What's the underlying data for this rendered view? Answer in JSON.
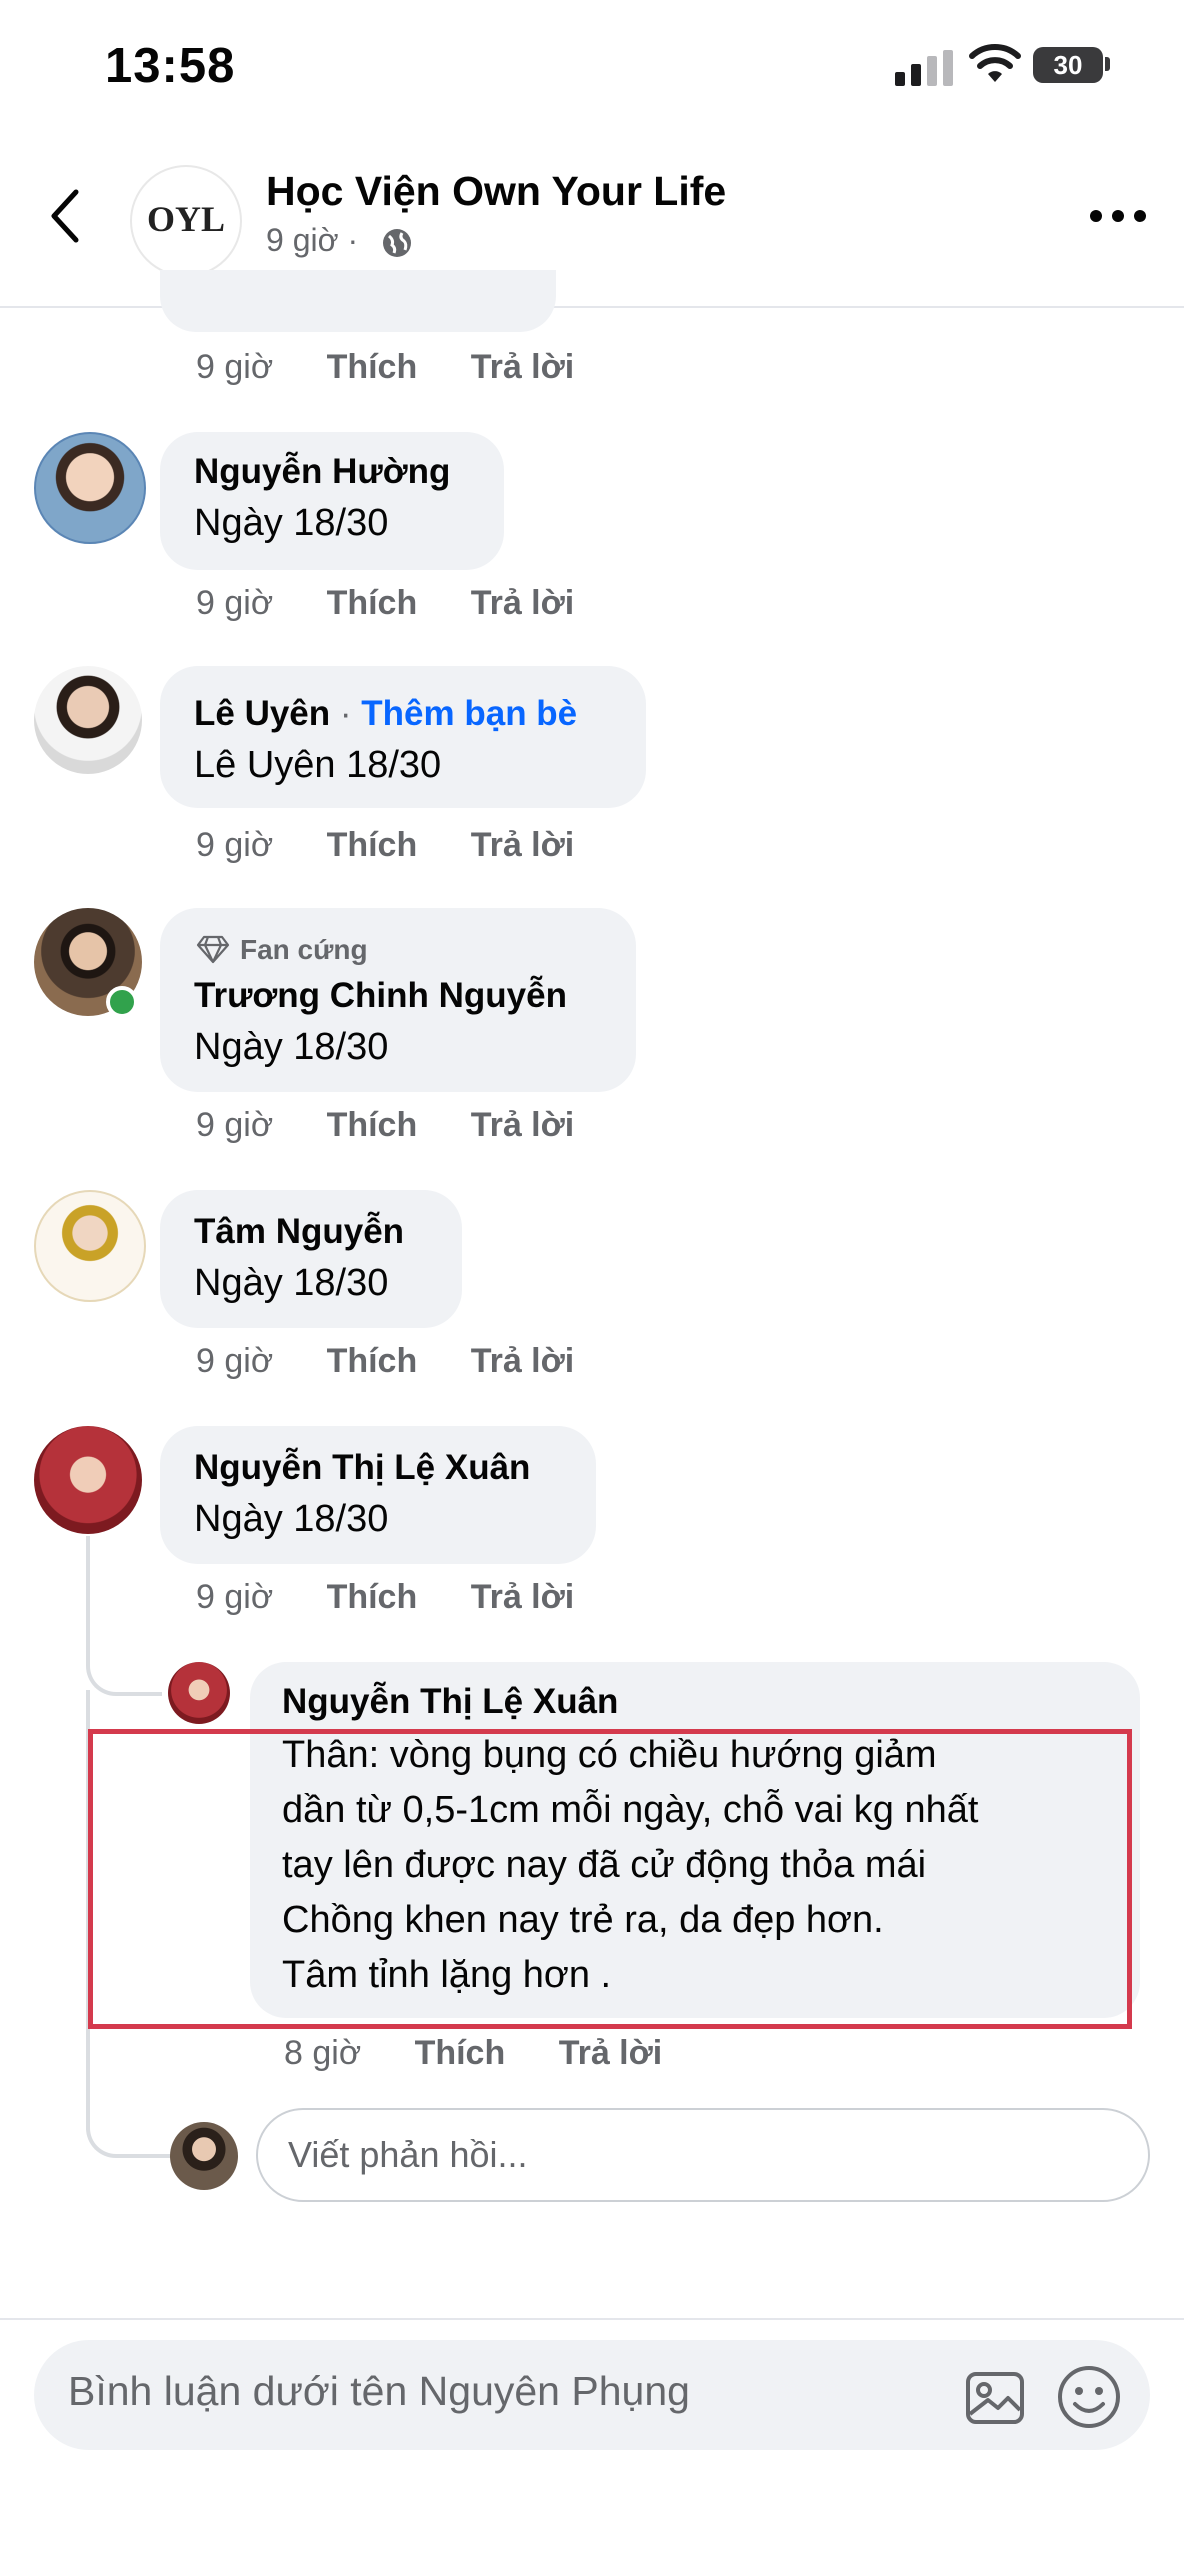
{
  "status_bar": {
    "time": "13:58",
    "battery": "30"
  },
  "header": {
    "page_name": "Học Viện Own Your Life",
    "meta": "9 giờ ·",
    "logo_text": "OYL"
  },
  "top_comment": {
    "time": "9 giờ",
    "like": "Thích",
    "reply": "Trả lời"
  },
  "comments": [
    {
      "name": "Nguyễn Hường",
      "text": "Ngày 18/30",
      "time": "9 giờ",
      "like": "Thích",
      "reply": "Trả lời"
    },
    {
      "name": "Lê Uyên",
      "add_friend": "Thêm bạn bè",
      "text": "Lê Uyên 18/30",
      "time": "9 giờ",
      "like": "Thích",
      "reply": "Trả lời"
    },
    {
      "badge": "Fan cứng",
      "name": "Trương Chinh Nguyễn",
      "text": "Ngày 18/30",
      "time": "9 giờ",
      "like": "Thích",
      "reply": "Trả lời"
    },
    {
      "name": "Tâm Nguyễn",
      "text": "Ngày 18/30",
      "time": "9 giờ",
      "like": "Thích",
      "reply": "Trả lời"
    },
    {
      "name": "Nguyễn Thị Lệ Xuân",
      "text": "Ngày 18/30",
      "time": "9 giờ",
      "like": "Thích",
      "reply": "Trả lời"
    }
  ],
  "reply": {
    "name": "Nguyễn Thị Lệ Xuân",
    "lines": [
      "Thân: vòng bụng có chiều hướng giảm",
      "dần từ 0,5-1cm mỗi ngày, chỗ vai kg nhất",
      "tay lên được nay đã cử động thỏa mái",
      "Chồng khen nay trẻ ra, da đẹp hơn.",
      "Tâm tỉnh lặng hơn ."
    ],
    "time": "8 giờ",
    "like": "Thích",
    "reply": "Trả lời"
  },
  "reply_input": {
    "placeholder": "Viết phản hồi..."
  },
  "comment_bar": {
    "placeholder": "Bình luận dưới tên Nguyên Phụng"
  },
  "colors": {
    "link": "#0866ff",
    "highlight": "#d43a4d",
    "bubble": "#f0f2f5",
    "meta": "#65676b"
  }
}
